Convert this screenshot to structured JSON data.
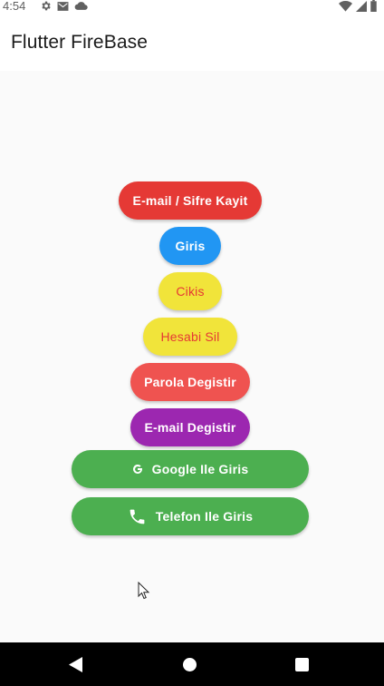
{
  "status_bar": {
    "time": "4:54"
  },
  "app_bar": {
    "title": "Flutter FireBase"
  },
  "buttons": {
    "register": {
      "label": "E-mail / Sifre Kayit",
      "color": "#e53935"
    },
    "login": {
      "label": "Giris",
      "color": "#2196f3"
    },
    "logout": {
      "label": "Cikis",
      "color": "#f1e43a",
      "text_color": "#e53935"
    },
    "delete_account": {
      "label": "Hesabi Sil",
      "color": "#f1e43a",
      "text_color": "#e53935"
    },
    "change_password": {
      "label": "Parola Degistir",
      "color": "#ef5350"
    },
    "change_email": {
      "label": "E-mail Degistir",
      "color": "#9c27b0"
    },
    "google_login": {
      "label": "Google Ile Giris",
      "icon": "google-g-icon",
      "color": "#4caf50"
    },
    "phone_login": {
      "label": "Telefon Ile Giris",
      "icon": "phone-icon",
      "color": "#4caf50"
    }
  },
  "nav_bar": {
    "icons": [
      "back-icon",
      "home-icon",
      "recent-apps-icon"
    ]
  }
}
